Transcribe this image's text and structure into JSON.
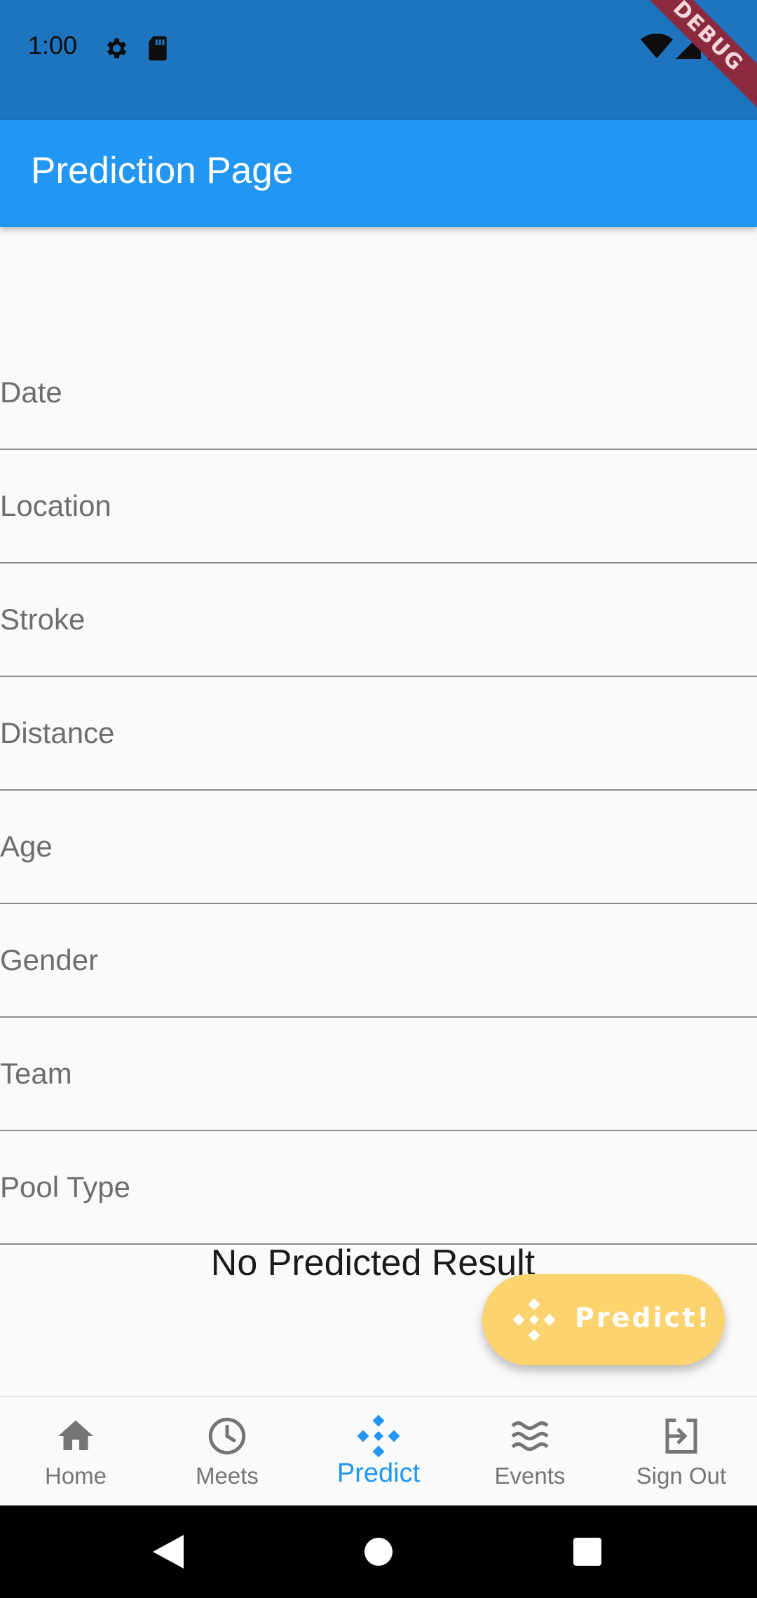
{
  "status_bar": {
    "time": "1:00",
    "debug_label": "DEBUG",
    "background": "#1f74bf"
  },
  "app_bar": {
    "title": "Prediction Page",
    "color": "#2196f3"
  },
  "form": {
    "fields": [
      {
        "label": "Date"
      },
      {
        "label": "Location"
      },
      {
        "label": "Stroke"
      },
      {
        "label": "Distance"
      },
      {
        "label": "Age"
      },
      {
        "label": "Gender"
      },
      {
        "label": "Team"
      },
      {
        "label": "Pool Type"
      }
    ]
  },
  "result": {
    "text": "No Predicted Result"
  },
  "fab": {
    "label": "Predict!",
    "icon": "binance-diamond-icon",
    "color": "#fdd36f"
  },
  "bottom_nav": {
    "items": [
      {
        "label": "Home",
        "icon": "home-icon",
        "active": false
      },
      {
        "label": "Meets",
        "icon": "clock-icon",
        "active": false
      },
      {
        "label": "Predict",
        "icon": "diamond-cluster-icon",
        "active": true
      },
      {
        "label": "Events",
        "icon": "waves-icon",
        "active": false
      },
      {
        "label": "Sign Out",
        "icon": "exit-icon",
        "active": false
      }
    ],
    "active_color": "#2196f3",
    "inactive_color": "#757575"
  },
  "system_nav": {
    "buttons": [
      "back-icon",
      "home-circle-icon",
      "recents-icon"
    ]
  }
}
